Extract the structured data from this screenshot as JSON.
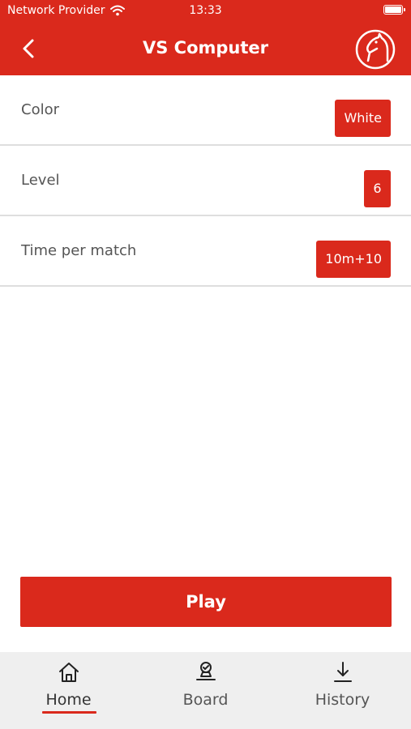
{
  "status": {
    "carrier": "Network Provider",
    "time": "13:33"
  },
  "nav": {
    "title": "VS Computer"
  },
  "settings": [
    {
      "label": "Color",
      "value": "White"
    },
    {
      "label": "Level",
      "value": "6"
    },
    {
      "label": "Time per match",
      "value": "10m+10"
    }
  ],
  "play_label": "Play",
  "tabs": [
    {
      "label": "Home",
      "icon": "home-icon",
      "active": true
    },
    {
      "label": "Board",
      "icon": "board-icon",
      "active": false
    },
    {
      "label": "History",
      "icon": "download-icon",
      "active": false
    }
  ],
  "colors": {
    "accent": "#da291c",
    "tab_bar": "#efefef"
  }
}
